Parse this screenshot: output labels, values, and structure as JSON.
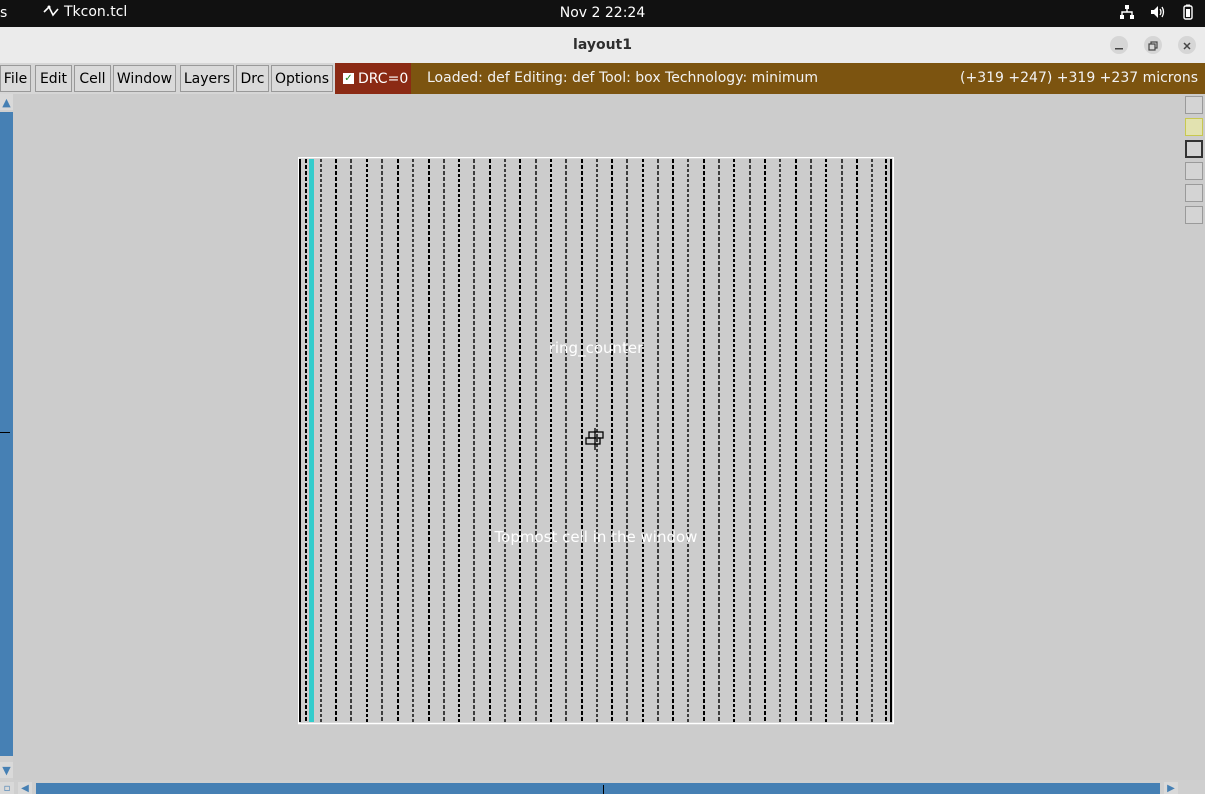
{
  "topbar": {
    "left_fragment": "s",
    "app_name": "Tkcon.tcl",
    "clock": "Nov 2  22:24",
    "tray_icons": [
      "network-icon",
      "volume-icon",
      "battery-icon"
    ]
  },
  "window": {
    "title": "layout1",
    "controls": [
      "minimize",
      "maximize",
      "close"
    ]
  },
  "menu": {
    "items": [
      "File",
      "Edit",
      "Cell",
      "Window",
      "Layers",
      "Drc",
      "Options"
    ]
  },
  "drc": {
    "label": "DRC=0",
    "checked": true
  },
  "status": {
    "info": "Loaded: def Editing: def Tool: box  Technology: minimum",
    "coords": "(+319 +247) +319 +237 microns"
  },
  "layout": {
    "cell_name": "ring_counter",
    "topmost_label": "Topmost cell in the window"
  },
  "colors": {
    "canvas_bg": "#cccccc",
    "drc_bg": "#8b2a14",
    "status_bg": "#7c5410",
    "scroll_blue": "#4680b4",
    "metal_cyan": "#33cccc"
  }
}
